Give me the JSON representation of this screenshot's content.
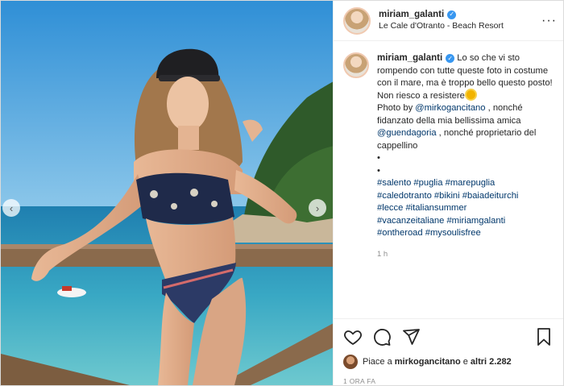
{
  "post": {
    "username": "miriam_galanti",
    "location": "Le Cale d'Otranto - Beach Resort",
    "caption": {
      "text1": "Lo so che vi sto rompendo con tutte queste foto in costume con il mare, ma è troppo bello questo posto! Non riesco a resistere",
      "text2a": "Photo by ",
      "mention1": "@mirkogancitano",
      "text2b": " , nonché fidanzato della mia bellissima amica ",
      "mention2": "@guendagoria",
      "text2c": " , nonché proprietario del cappellino",
      "bullet1": "•",
      "bullet2": "•",
      "hashtags": [
        "#salento",
        "#puglia",
        "#marepuglia",
        "#caledotranto",
        "#bikini",
        "#baiadeiturchi",
        "#lecce",
        "#italiansummer",
        "#vacanzeitaliane",
        "#miriamgalanti",
        "#ontheroad",
        "#mysoulisfree"
      ]
    },
    "caption_time": "1 h",
    "likes_prefix": "Piace a ",
    "likes_user": "mirkogancitano",
    "likes_suffix": " e ",
    "likes_others": "altri 2.282",
    "posted_ago": "1 ORA FA"
  },
  "icons": {
    "more": "ellipsis-icon",
    "like": "heart-icon",
    "comment": "comment-icon",
    "share": "paper-plane-icon",
    "save": "bookmark-icon",
    "prev": "chevron-left-icon",
    "next": "chevron-right-icon"
  },
  "colors": {
    "link": "#00376b",
    "verified": "#3897f0",
    "muted": "#8e8e8e"
  }
}
